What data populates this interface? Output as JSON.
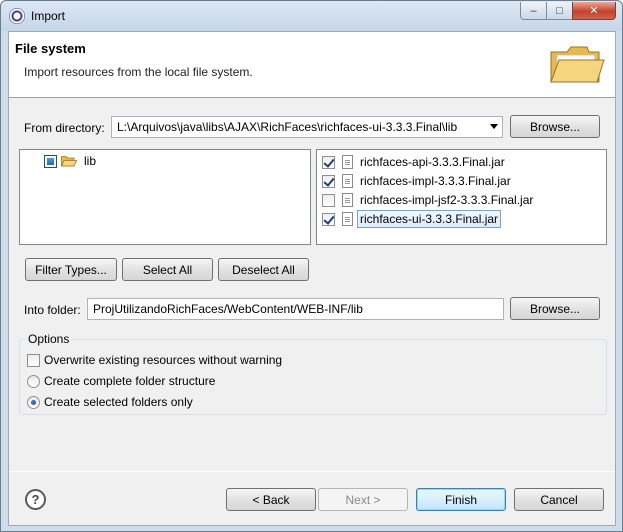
{
  "window": {
    "title": "Import",
    "controls": {
      "minimize": "–",
      "maximize": "□",
      "close": "✕"
    }
  },
  "header": {
    "title": "File system",
    "description": "Import resources from the local file system.",
    "icon": "folder-icon"
  },
  "from_directory": {
    "label": "From directory:",
    "value": "L:\\Arquivos\\java\\libs\\AJAX\\RichFaces\\richfaces-ui-3.3.3.Final\\lib",
    "browse_label": "Browse..."
  },
  "tree": {
    "items": [
      {
        "label": "lib",
        "state": "partial",
        "icon": "folder-open-icon"
      }
    ]
  },
  "files": [
    {
      "label": "richfaces-api-3.3.3.Final.jar",
      "checked": true,
      "selected": false
    },
    {
      "label": "richfaces-impl-3.3.3.Final.jar",
      "checked": true,
      "selected": false
    },
    {
      "label": "richfaces-impl-jsf2-3.3.3.Final.jar",
      "checked": false,
      "selected": false
    },
    {
      "label": "richfaces-ui-3.3.3.Final.jar",
      "checked": true,
      "selected": true
    }
  ],
  "selection_buttons": {
    "filter_types": "Filter Types...",
    "select_all": "Select All",
    "deselect_all": "Deselect All"
  },
  "into_folder": {
    "label": "Into folder:",
    "value": "ProjUtilizandoRichFaces/WebContent/WEB-INF/lib",
    "browse_label": "Browse..."
  },
  "options": {
    "legend": "Options",
    "overwrite": {
      "label": "Overwrite existing resources without warning",
      "checked": false
    },
    "structure": [
      {
        "label": "Create complete folder structure",
        "selected": false
      },
      {
        "label": "Create selected folders only",
        "selected": true
      }
    ]
  },
  "footer": {
    "help": "?",
    "back": "< Back",
    "next": "Next >",
    "finish": "Finish",
    "cancel": "Cancel"
  }
}
